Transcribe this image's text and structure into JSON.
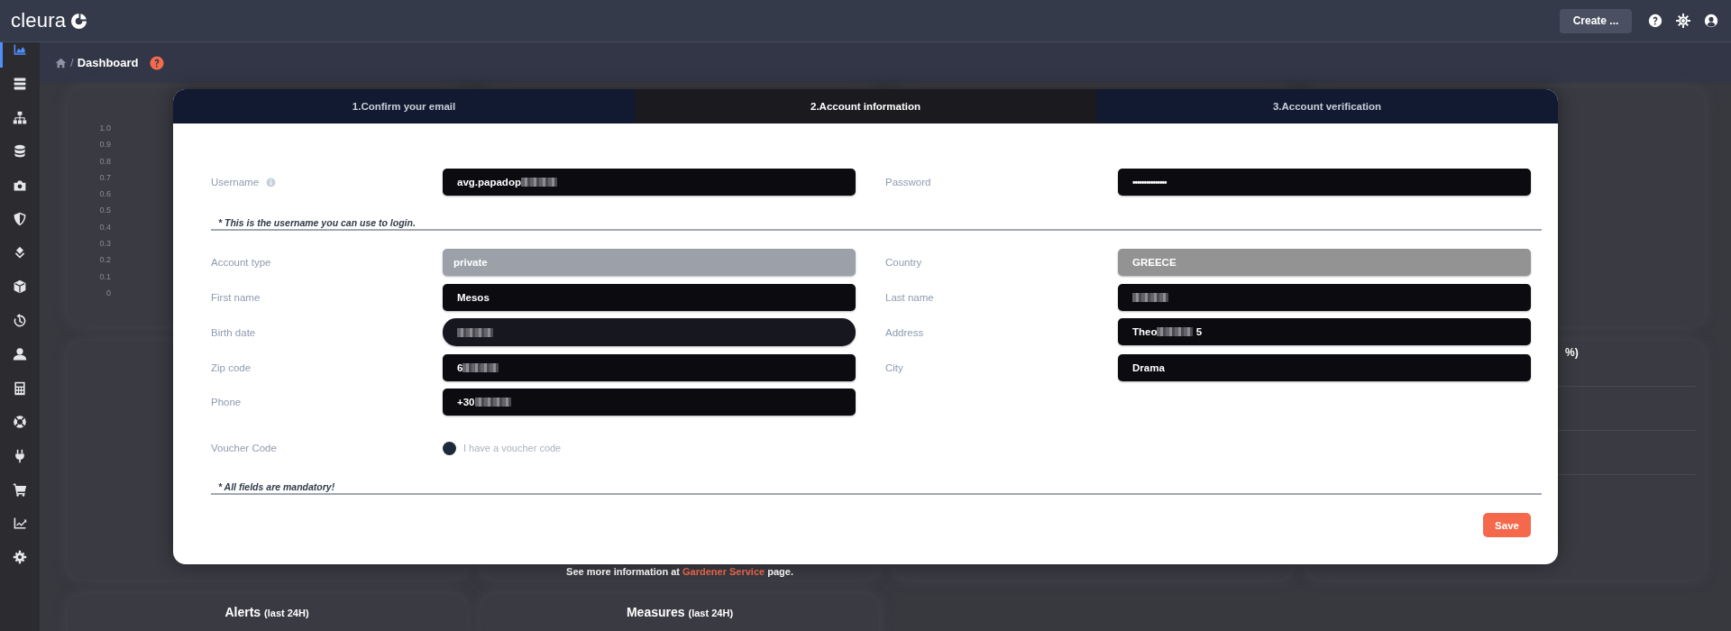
{
  "header": {
    "logo": "cleura",
    "create_button": "Create ..."
  },
  "sidebar": {
    "items": [
      {
        "selected": true
      },
      {
        "selected": false
      },
      {
        "selected": false
      },
      {
        "selected": false
      },
      {
        "selected": false
      },
      {
        "selected": false
      },
      {
        "selected": false
      },
      {
        "selected": false
      },
      {
        "selected": false
      },
      {
        "selected": false
      },
      {
        "selected": false
      },
      {
        "selected": false
      },
      {
        "selected": false
      },
      {
        "selected": false
      },
      {
        "selected": false
      },
      {
        "selected": false
      }
    ]
  },
  "breadcrumb": {
    "separator": "/",
    "current": "Dashboard"
  },
  "dashboard": {
    "axis_labels": [
      "1.0",
      "0.9",
      "0.8",
      "0.7",
      "0.6",
      "0.5",
      "0.4",
      "0.3",
      "0.2",
      "0.1",
      "0"
    ],
    "info_text": {
      "before": "See more information at",
      "link": "Gardener Service",
      "after": "page."
    },
    "partial_title": "%)",
    "bottom_cards": [
      {
        "title": "Alerts",
        "subtitle": "(last 24H)"
      },
      {
        "title": "Measures",
        "subtitle": "(last 24H)"
      }
    ]
  },
  "modal": {
    "tabs": [
      {
        "label": "1.Confirm your email",
        "selected": false
      },
      {
        "label": "2.Account information",
        "selected": true
      },
      {
        "label": "3.Account verification",
        "selected": false
      }
    ],
    "top_fields": [
      {
        "label": "Username",
        "info": true,
        "kind": "text",
        "value": "avg.papadop",
        "redacted": true
      },
      {
        "label": "Password",
        "kind": "password",
        "value": "•••••••••••••••"
      }
    ],
    "username_hint": "* This is the username you can use to login.",
    "left_fields": [
      {
        "label": "Account type",
        "kind": "readonly",
        "value": "private"
      },
      {
        "label": "First name",
        "kind": "text",
        "value": "Mesos"
      },
      {
        "label": "Birth date",
        "kind": "date",
        "redacted": true
      },
      {
        "label": "Zip code",
        "kind": "text",
        "value": "6",
        "redacted": true
      },
      {
        "label": "Phone",
        "kind": "text",
        "value": "+30",
        "redacted": true
      }
    ],
    "right_fields": [
      {
        "label": "Country",
        "kind": "select",
        "value": "GREECE"
      },
      {
        "label": "Last name",
        "kind": "text",
        "redacted": true
      },
      {
        "label": "Address",
        "kind": "text",
        "value": "Theo",
        "redacted": true,
        "value_after": "5"
      },
      {
        "label": "City",
        "kind": "text",
        "value": "Drama"
      }
    ],
    "voucher": {
      "label": "Voucher Code",
      "option": "I have a voucher code",
      "checked": false
    },
    "mandatory_note": "* All fields are mandatory!",
    "save_button": "Save"
  }
}
